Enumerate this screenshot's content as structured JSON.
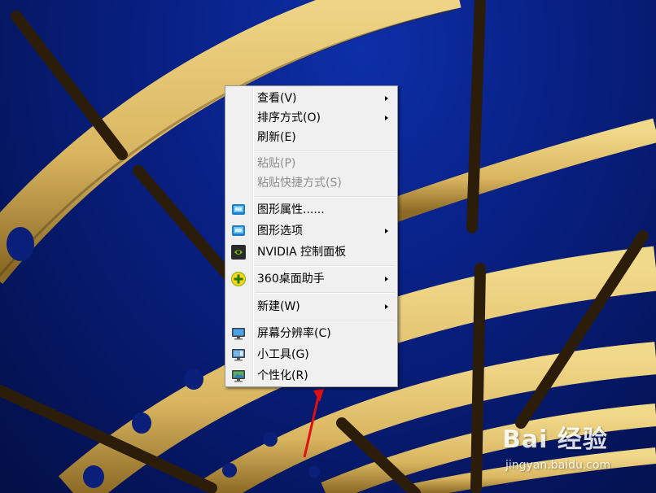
{
  "menu": {
    "items": [
      {
        "label": "查看(V)",
        "submenu": true,
        "enabled": true,
        "icon": null
      },
      {
        "label": "排序方式(O)",
        "submenu": true,
        "enabled": true,
        "icon": null
      },
      {
        "label": "刷新(E)",
        "submenu": false,
        "enabled": true,
        "icon": null
      },
      {
        "label": "粘贴(P)",
        "submenu": false,
        "enabled": false,
        "icon": null
      },
      {
        "label": "粘贴快捷方式(S)",
        "submenu": false,
        "enabled": false,
        "icon": null
      },
      {
        "label": "图形属性......",
        "submenu": false,
        "enabled": true,
        "icon": "intel-graphics-icon"
      },
      {
        "label": "图形选项",
        "submenu": true,
        "enabled": true,
        "icon": "intel-graphics-options-icon"
      },
      {
        "label": "NVIDIA 控制面板",
        "submenu": false,
        "enabled": true,
        "icon": "nvidia-icon"
      },
      {
        "label": "360桌面助手",
        "submenu": true,
        "enabled": true,
        "icon": "360-plus-icon"
      },
      {
        "label": "新建(W)",
        "submenu": true,
        "enabled": true,
        "icon": null
      },
      {
        "label": "屏幕分辨率(C)",
        "submenu": false,
        "enabled": true,
        "icon": "screen-resolution-icon"
      },
      {
        "label": "小工具(G)",
        "submenu": false,
        "enabled": true,
        "icon": "gadgets-icon"
      },
      {
        "label": "个性化(R)",
        "submenu": false,
        "enabled": true,
        "icon": "personalize-icon"
      }
    ]
  },
  "watermark": {
    "brand": "Bai 经验",
    "url": "jingyan.baidu.com"
  },
  "colors": {
    "sky": "#082083",
    "beam": "#e8c96a",
    "menu_bg": "#f0f0f0",
    "annotation_arrow": "#e01010"
  }
}
